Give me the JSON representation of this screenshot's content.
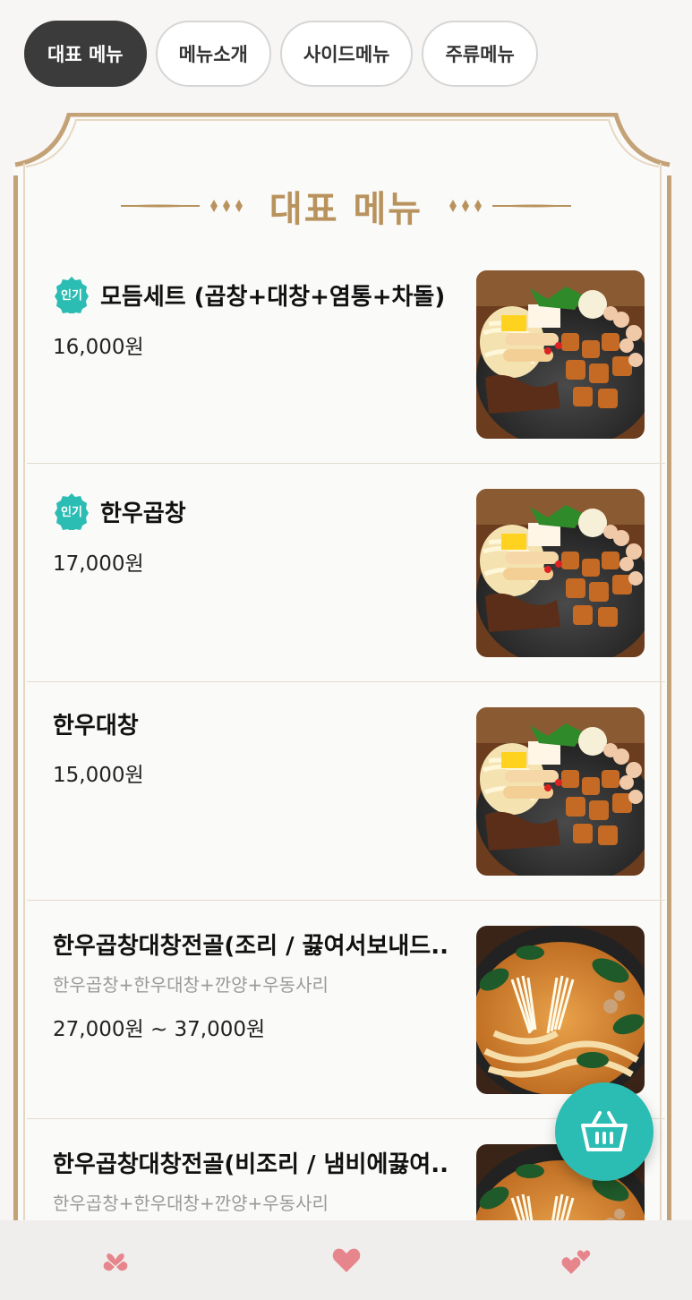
{
  "tabs": [
    {
      "label": "대표 메뉴",
      "active": true
    },
    {
      "label": "메뉴소개",
      "active": false
    },
    {
      "label": "사이드메뉴",
      "active": false
    },
    {
      "label": "주류메뉴",
      "active": false
    }
  ],
  "section": {
    "title": "대표 메뉴"
  },
  "badge_label": "인기",
  "items": [
    {
      "name": "모듬세트 (곱창+대창+염통+차돌)",
      "popular": true,
      "description": "",
      "price": "16,000원",
      "image": "grilled-gopchang-platter"
    },
    {
      "name": "한우곱창",
      "popular": true,
      "description": "",
      "price": "17,000원",
      "image": "grilled-gopchang-platter"
    },
    {
      "name": "한우대창",
      "popular": false,
      "description": "",
      "price": "15,000원",
      "image": "grilled-gopchang-platter"
    },
    {
      "name": "한우곱창대창전골(조리 / 끓여서보내드...",
      "popular": false,
      "description": "한우곱창+한우대창+깐양+우동사리",
      "price": "27,000원 ~ 37,000원",
      "image": "gopchang-jeongol-hotpot"
    },
    {
      "name": "한우곱창대창전골(비조리 / 냄비에끓여...",
      "popular": false,
      "description": "한우곱창+한우대창+깐양+우동사리",
      "price": "",
      "image": "gopchang-jeongol-hotpot"
    }
  ],
  "cart_icon": "basket-icon",
  "bottom_nav": [
    {
      "icon": "clover-hearts-icon"
    },
    {
      "icon": "heart-icon"
    },
    {
      "icon": "twin-hearts-icon"
    }
  ],
  "colors": {
    "accent_gold": "#c4a277",
    "badge_teal": "#2bbdb3",
    "tab_active": "#3b3b3b",
    "heart_pink": "#e6858c"
  }
}
